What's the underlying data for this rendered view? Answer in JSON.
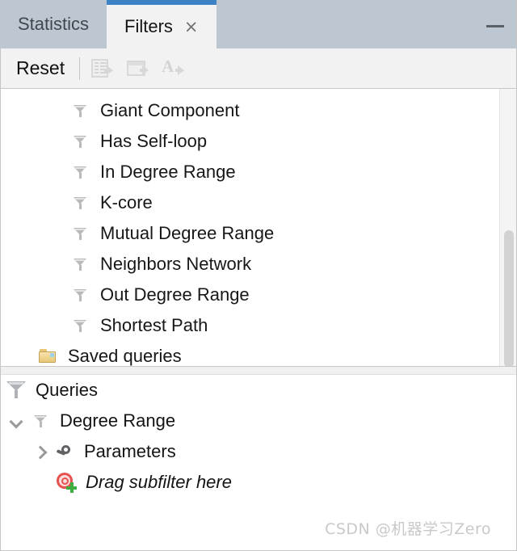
{
  "window": {
    "minimize_label": "–"
  },
  "tabs": [
    {
      "label": "Statistics",
      "active": false,
      "closable": false
    },
    {
      "label": "Filters",
      "active": true,
      "closable": true,
      "close_glyph": "×"
    }
  ],
  "toolbar": {
    "reset_label": "Reset",
    "buttons": [
      {
        "name": "export-table-button",
        "icon": "table-export-icon",
        "enabled": false
      },
      {
        "name": "export-workspace-button",
        "icon": "window-export-icon",
        "enabled": false
      },
      {
        "name": "export-labels-button",
        "icon": "label-export-icon",
        "enabled": false
      }
    ]
  },
  "filter_list": {
    "items": [
      {
        "label": "Giant Component",
        "icon": "funnel-icon",
        "depth": 2
      },
      {
        "label": "Has Self-loop",
        "icon": "funnel-icon",
        "depth": 2
      },
      {
        "label": "In Degree Range",
        "icon": "funnel-icon",
        "depth": 2
      },
      {
        "label": "K-core",
        "icon": "funnel-icon",
        "depth": 2
      },
      {
        "label": "Mutual Degree Range",
        "icon": "funnel-icon",
        "depth": 2
      },
      {
        "label": "Neighbors Network",
        "icon": "funnel-icon",
        "depth": 2
      },
      {
        "label": "Out Degree Range",
        "icon": "funnel-icon",
        "depth": 2
      },
      {
        "label": "Shortest Path",
        "icon": "funnel-icon",
        "depth": 2
      },
      {
        "label": "Saved queries",
        "icon": "folder-icon",
        "depth": 1
      }
    ],
    "scrollbar": {
      "thumb_top_pct": 50,
      "thumb_height_pct": 50
    }
  },
  "queries": {
    "root_label": "Queries",
    "root_icon": "funnel-icon",
    "nodes": [
      {
        "label": "Degree Range",
        "icon": "funnel-icon",
        "expanded": true,
        "twisty": "chevron-down-icon",
        "indent": 1
      },
      {
        "label": "Parameters",
        "icon": "wrench-icon",
        "expanded": false,
        "twisty": "chevron-right-icon",
        "indent": 2
      },
      {
        "label": "Drag subfilter here",
        "icon": "add-target-icon",
        "italic": true,
        "indent": 3
      }
    ]
  },
  "watermark": {
    "text": "CSDN @机器学习Zero"
  },
  "colors": {
    "accent_blue": "#3c82c4",
    "tabbar_bg": "#bcc7d1",
    "toolbar_bg": "#f2f2f2",
    "panel_bg": "#ffffff",
    "folder_yellow": "#e8c878",
    "target_red": "#e8504f",
    "plus_green": "#3fad3f"
  }
}
